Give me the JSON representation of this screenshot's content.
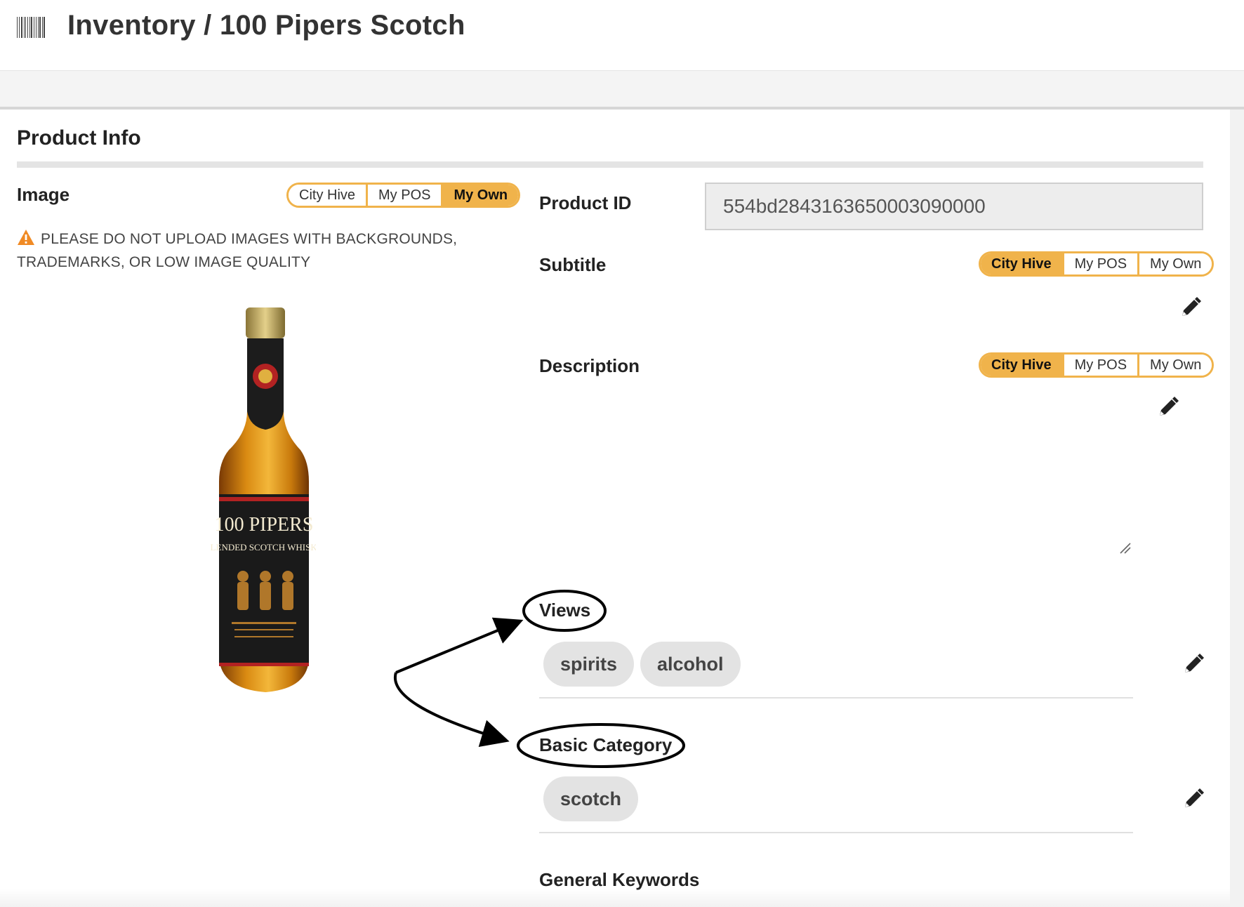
{
  "header": {
    "title": "Inventory / 100 Pipers Scotch",
    "icon": "barcode-icon"
  },
  "product_info": {
    "section_title": "Product Info",
    "image": {
      "label": "Image",
      "source_options": [
        "City Hive",
        "My POS",
        "My Own"
      ],
      "selected": "My Own",
      "warning_line1": "PLEASE DO NOT UPLOAD IMAGES WITH BACKGROUNDS,",
      "warning_line2": "TRADEMARKS, OR LOW IMAGE QUALITY",
      "bottle_label_top": "100 PIPERS",
      "bottle_label_bottom": "BLENDED SCOTCH WHISKY"
    },
    "product_id": {
      "label": "Product ID",
      "value": "554bd2843163650003090000"
    },
    "subtitle": {
      "label": "Subtitle",
      "source_options": [
        "City Hive",
        "My POS",
        "My Own"
      ],
      "selected": "City Hive"
    },
    "description": {
      "label": "Description",
      "source_options": [
        "City Hive",
        "My POS",
        "My Own"
      ],
      "selected": "City Hive"
    },
    "views": {
      "label": "Views",
      "tags": [
        "spirits",
        "alcohol"
      ]
    },
    "basic_category": {
      "label": "Basic Category",
      "tags": [
        "scotch"
      ]
    },
    "general_keywords": {
      "label": "General Keywords"
    }
  },
  "colors": {
    "accent": "#f0b34b",
    "tag_bg": "#e3e3e3",
    "warning": "#f08a24"
  }
}
